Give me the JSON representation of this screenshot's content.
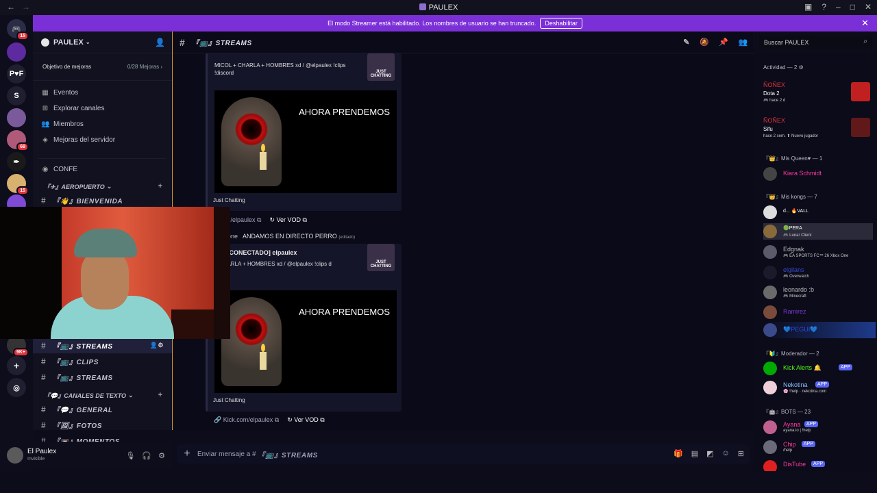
{
  "titlebar": {
    "title": "PAULEX"
  },
  "banner": {
    "text": "El modo Streamer está habilitado. Los nombres de usuario se han truncado.",
    "button": "Deshabilitar"
  },
  "server": {
    "name": "PAULEX",
    "goal_label": "Objetivo de mejoras",
    "goal_count": "0/28 Mejoras"
  },
  "server_list": [
    {
      "label": "P♥F"
    },
    {
      "label": "S"
    }
  ],
  "badges": {
    "b1": "15",
    "b2": "69",
    "b3": "15",
    "b4": "9K+"
  },
  "menu": [
    {
      "icon": "calendar-icon",
      "label": "Eventos"
    },
    {
      "icon": "compass-icon",
      "label": "Explorar canales"
    },
    {
      "icon": "members-icon",
      "label": "Miembros"
    },
    {
      "icon": "boost-icon",
      "label": "Mejoras del servidor"
    }
  ],
  "channels": {
    "confe": "CONFE",
    "cat_aeropuerto": "『✈』AEROPUERTO",
    "bienvenida": "『👋』BIENVENIDA",
    "streams_active": "『📺』STREAMS",
    "clips": "『📺』CLIPS",
    "streams2": "『📺』STREAMS",
    "cat_texto": "『💬』CANALES DE TEXTO",
    "general": "『💬』GENERAL",
    "fotos": "『🖼』FOTOS",
    "momentos": "『📼』MOMENTOS"
  },
  "chat": {
    "channel": "『📺』STREAMS",
    "embed1": {
      "desc": "MICOL + CHARLA + HOMBRES xd / @elpaulex !clips !discord",
      "image_text": "AHORA PRENDEMOS",
      "category": "Just Chatting",
      "link": "...com/elpaulex",
      "vod": "Ver VOD"
    },
    "message": {
      "author": "one",
      "text": "ANDAMOS EN DIRECTO PERRO",
      "edited": "(editado)"
    },
    "embed2": {
      "title": "[DESCONECTADO] elpaulex",
      "desc": "+ CHARLA + HOMBRES xd / @elpaulex !clips d",
      "image_text": "AHORA PRENDEMOS",
      "category": "Just Chatting",
      "link": "Kick.com/elpaulex",
      "vod": "Ver VOD"
    },
    "thumb_text": "JUST CHATTING",
    "composer_placeholder": "Enviar mensaje a #",
    "composer_channel": "『📺』STREAMS"
  },
  "search": {
    "placeholder": "Buscar PAULEX"
  },
  "user": {
    "name": "El Paulex",
    "status": "Invisible"
  },
  "members": {
    "activity": "Actividad — 2",
    "act1": {
      "name": "ÑOÑEX",
      "game": "Dota 2",
      "time": "🎮 hace 2 d"
    },
    "act2": {
      "name": "ÑOÑEX",
      "game": "Sifu",
      "time": "hace 2 sem.  ⬆ Nuevo jugador"
    },
    "group1": "『👑』Mis Queen♥ — 1",
    "m_kiara": "Kiara Schmidt",
    "group2": "『👑』Mis kongs — 7",
    "m_a": "d...   🔥VALL",
    "m_b": "🟢PERA",
    "m_b_s": "🎮 Lunar Client",
    "m_edgnak": "Edgnak",
    "m_edgnak_s": "🎮 EA SPORTS FC™ 26 Xbox One",
    "m_elg": "elgilans",
    "m_elg_s": "🎮 Overwatch",
    "m_leo": "leonardo :b",
    "m_leo_s": "🎮 Minecraft",
    "m_ramirez": "Ramirez",
    "m_pegui": "💙PEGUI💙",
    "group3": "『🔰』Moderador — 2",
    "m_kick": "Kick Alerts 🔔",
    "m_nek": "Nekotina",
    "m_nek_s": "🌸 !help · nekotina.com",
    "group4": "『🤖』BOTS — 23",
    "m_ayana": "Ayana",
    "m_ayana_s": "ayana.io | !help",
    "m_chip": "Chip",
    "m_chip_s": "/help",
    "m_dis": "DisTube",
    "app": "APP"
  },
  "colors": {
    "accent": "#7b2fd6",
    "ember": "#d49a2c",
    "red_name": "#e0343c",
    "pink_name": "#ff3aa0"
  }
}
